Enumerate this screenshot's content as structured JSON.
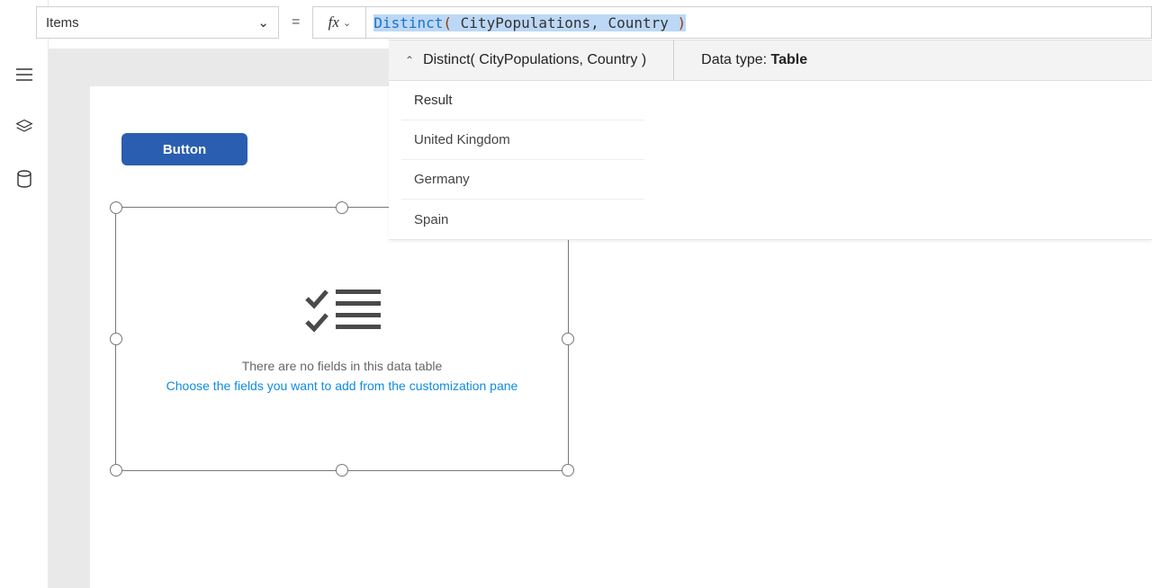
{
  "propertySelector": {
    "value": "Items"
  },
  "formula": {
    "func": "Distinct",
    "openParen": "( ",
    "arg1": "CityPopulations",
    "comma": ", ",
    "arg2": "Country ",
    "closeParen": ")"
  },
  "resultBar": {
    "signature": "Distinct( CityPopulations, Country )",
    "dataTypeLabel": "Data type: ",
    "dataTypeValue": "Table"
  },
  "results": {
    "header": "Result",
    "rows": [
      "United Kingdom",
      "Germany",
      "Spain"
    ]
  },
  "canvas": {
    "buttonLabel": "Button",
    "dtMsg1": "There are no fields in this data table",
    "dtMsg2": "Choose the fields you want to add from the customization pane"
  },
  "equals": "="
}
